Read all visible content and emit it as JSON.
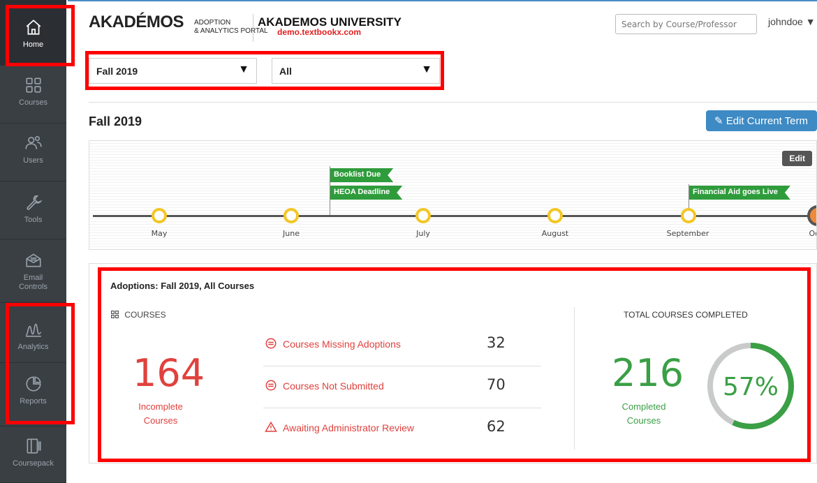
{
  "sidebar": {
    "items": [
      {
        "label": "Home",
        "icon": "home-icon"
      },
      {
        "label": "Courses",
        "icon": "grid-icon"
      },
      {
        "label": "Users",
        "icon": "users-icon"
      },
      {
        "label": "Tools",
        "icon": "wrench-icon"
      },
      {
        "label": "Email Controls",
        "icon": "email-icon"
      },
      {
        "label": "Analytics",
        "icon": "analytics-icon"
      },
      {
        "label": "Reports",
        "icon": "pie-chart-icon"
      },
      {
        "label": "Coursepack",
        "icon": "coursepack-icon"
      }
    ]
  },
  "header": {
    "brand": "AKADÉMOS",
    "brand_sub_1": "ADOPTION",
    "brand_sub_2": "& ANALYTICS PORTAL",
    "university": "AKADEMOS UNIVERSITY",
    "url": "demo.textbookx.com",
    "search_placeholder": "Search by Course/Professor",
    "user": "johndoe ▼"
  },
  "filters": {
    "term": "Fall 2019",
    "scope": "All"
  },
  "term": {
    "title": "Fall 2019",
    "edit_label": "Edit Current Term"
  },
  "timeline": {
    "edit_label": "Edit",
    "months": [
      "May",
      "June",
      "July",
      "August",
      "September",
      "Oct"
    ],
    "flags": [
      "Booklist Due",
      "HEOA Deadline",
      "Financial Aid goes Live"
    ]
  },
  "adoptions": {
    "title": "Adoptions: Fall 2019, All Courses",
    "courses_header": "COURSES",
    "incomplete_count": "164",
    "incomplete_label_1": "Incomplete",
    "incomplete_label_2": "Courses",
    "metrics": [
      {
        "label": "Courses Missing Adoptions",
        "value": "32"
      },
      {
        "label": "Courses Not Submitted",
        "value": "70"
      },
      {
        "label": "Awaiting Administrator Review",
        "value": "62"
      }
    ],
    "total_header": "TOTAL COURSES COMPLETED",
    "completed_count": "216",
    "completed_label_1": "Completed",
    "completed_label_2": "Courses",
    "percent_text": "57%",
    "percent_value": 0.57
  },
  "colors": {
    "accent_blue": "#3d8ac4",
    "alert_red": "#e0413d",
    "success_green": "#3a9f45",
    "highlight": "#ff0000"
  }
}
